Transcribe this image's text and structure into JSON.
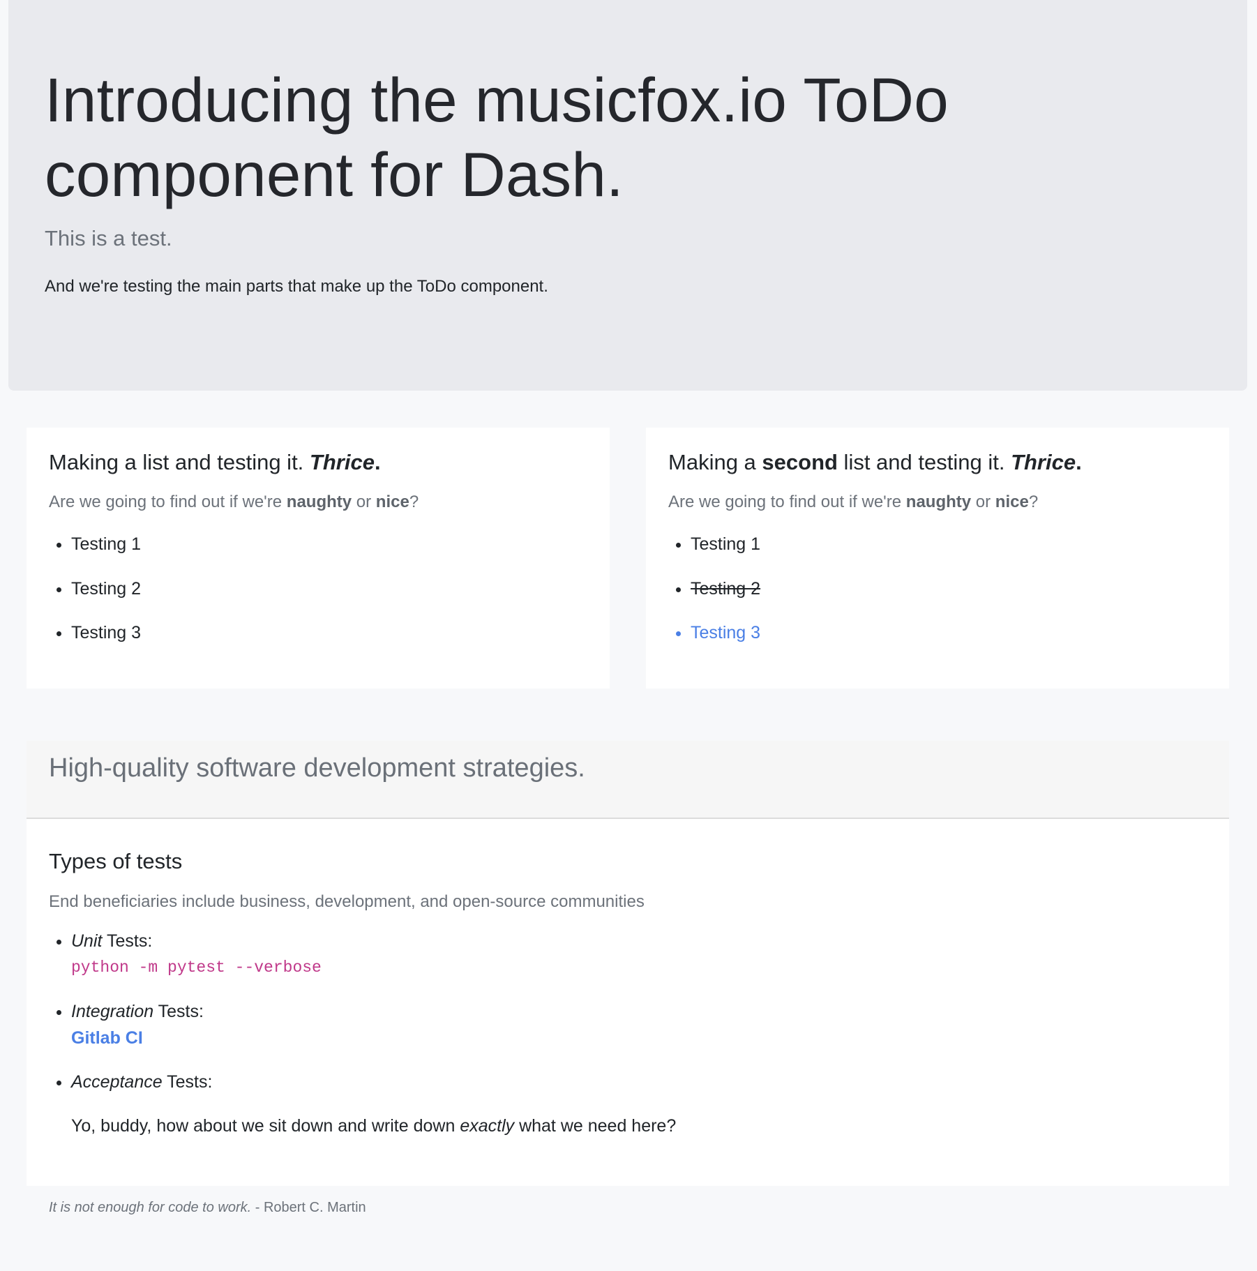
{
  "jumbotron": {
    "title": "Introducing the musicfox.io ToDo component for Dash.",
    "lead": "This is a test.",
    "text": "And we're testing the main parts that make up the ToDo component."
  },
  "card_left": {
    "title_main": "Making a list and testing it. ",
    "title_em": "Thrice",
    "title_end": ".",
    "subtitle_pre": "Are we going to find out if we're ",
    "subtitle_naughty": "naughty",
    "subtitle_or": " or ",
    "subtitle_nice": "nice",
    "subtitle_end": "?",
    "items": [
      {
        "label": "Testing 1"
      },
      {
        "label": "Testing 2"
      },
      {
        "label": "Testing 3"
      }
    ]
  },
  "card_right": {
    "title_pre": "Making a ",
    "title_strong": "second",
    "title_mid": " list and testing it. ",
    "title_em": "Thrice",
    "title_end": ".",
    "subtitle_pre": "Are we going to find out if we're ",
    "subtitle_naughty": "naughty",
    "subtitle_or": " or ",
    "subtitle_nice": "nice",
    "subtitle_end": "?",
    "items": [
      {
        "label": "Testing 1",
        "state": "normal"
      },
      {
        "label": "Testing 2",
        "state": "done"
      },
      {
        "label": "Testing 3",
        "state": "active"
      }
    ]
  },
  "strategies": {
    "header": "High-quality software development strategies.",
    "title": "Types of tests",
    "subtitle": "End beneficiaries include business, development, and open-source communities",
    "unit": {
      "em": "Unit",
      "label": " Tests:",
      "code": "python -m pytest --verbose"
    },
    "integration": {
      "em": "Integration",
      "label": " Tests:",
      "link": "Gitlab CI"
    },
    "acceptance": {
      "em": "Acceptance",
      "label": " Tests:",
      "text_pre": "Yo, buddy, how about we sit down and write down ",
      "text_em": "exactly",
      "text_post": " what we need here?"
    }
  },
  "footer": {
    "quote": "It is not enough for code to work.",
    "author": " - Robert C. Martin"
  },
  "colors": {
    "jumbotron_bg": "#e9eaee",
    "page_bg": "#f7f8fa",
    "link": "#4a7fe5",
    "code": "#c0398a",
    "muted": "#6c727a"
  }
}
